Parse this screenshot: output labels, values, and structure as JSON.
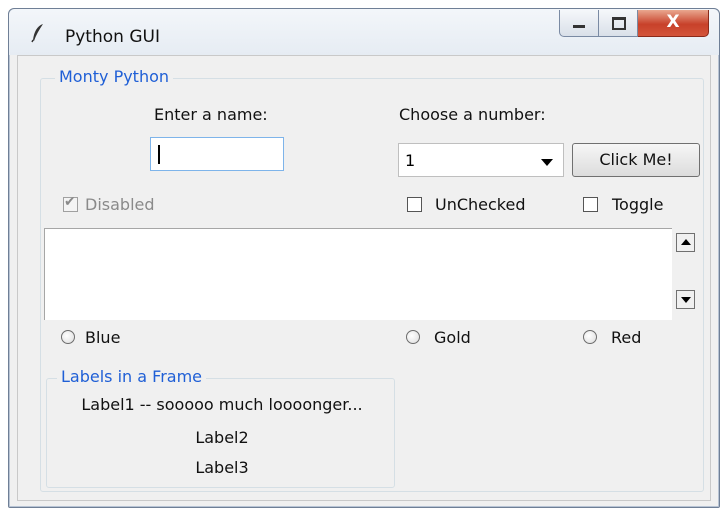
{
  "window": {
    "title": "Python GUI",
    "icon": "feather-icon",
    "controls": {
      "minimize": "minimize-icon",
      "maximize": "maximize-icon",
      "close_glyph": "X"
    }
  },
  "group": {
    "title": "Monty Python",
    "name_label": "Enter a name:",
    "name_value": "",
    "number_label": "Choose a number:",
    "number_selected": "1",
    "button_label": "Click Me!",
    "checkboxes": [
      {
        "label": "Disabled",
        "checked": true,
        "disabled": true
      },
      {
        "label": "UnChecked",
        "checked": false,
        "disabled": false
      },
      {
        "label": "Toggle",
        "checked": false,
        "disabled": false
      }
    ],
    "scrolled_text": "",
    "radios": [
      {
        "label": "Blue",
        "selected": false
      },
      {
        "label": "Gold",
        "selected": false
      },
      {
        "label": "Red",
        "selected": false
      }
    ]
  },
  "labels_frame": {
    "title": "Labels in a Frame",
    "labels": [
      "Label1 -- sooooo much loooonger...",
      "Label2",
      "Label3"
    ]
  },
  "colors": {
    "group_title": "#1f5fd6",
    "close_button": "#c8412a",
    "entry_focus_border": "#7eb4ea"
  }
}
